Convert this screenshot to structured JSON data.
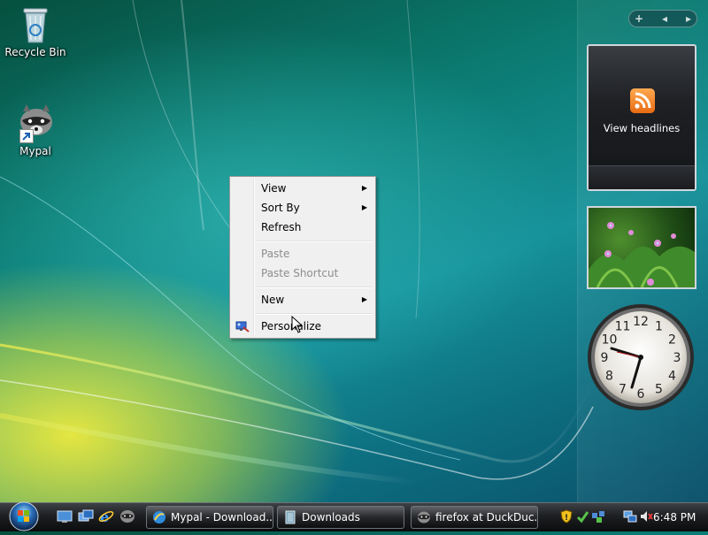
{
  "desktop": {
    "icons": [
      {
        "label": "Recycle Bin",
        "icon": "recycle-bin-icon"
      },
      {
        "label": "Mypal",
        "icon": "mypal-raccoon-icon"
      }
    ]
  },
  "sidebar": {
    "toolbar": {
      "add": "+",
      "prev": "◂",
      "next": "▸"
    },
    "feed_gadget": {
      "text": "View headlines",
      "icon": "rss-icon"
    },
    "slideshow_gadget": {
      "subject": "pink flowers and green plants"
    },
    "clock_gadget": {
      "numerals": [
        "12",
        "1",
        "2",
        "3",
        "4",
        "5",
        "6",
        "7",
        "8",
        "9",
        "10",
        "11"
      ],
      "time_shown": "6:48"
    }
  },
  "context_menu": {
    "items": [
      {
        "label": "View",
        "submenu": true,
        "enabled": true
      },
      {
        "label": "Sort By",
        "submenu": true,
        "enabled": true
      },
      {
        "label": "Refresh",
        "submenu": false,
        "enabled": true
      },
      {
        "label": "Paste",
        "submenu": false,
        "enabled": false
      },
      {
        "label": "Paste Shortcut",
        "submenu": false,
        "enabled": false
      },
      {
        "label": "New",
        "submenu": true,
        "enabled": true
      },
      {
        "label": "Personalize",
        "submenu": false,
        "enabled": true,
        "icon": "personalize-display-icon"
      }
    ],
    "submenu_arrow": "▶"
  },
  "taskbar": {
    "quick_launch": [
      "show-desktop-icon",
      "switch-windows-icon",
      "internet-explorer-icon",
      "mypal-icon"
    ],
    "tasks": [
      {
        "label": "Mypal - Download...",
        "icon": "mypal-browser-icon"
      },
      {
        "label": "Downloads",
        "icon": "folder-icon"
      },
      {
        "label": "firefox at DuckDuc...",
        "icon": "mypal-raccoon-icon"
      }
    ],
    "tray": {
      "icons": [
        "security-alert-shield-icon",
        "defender-icon",
        "network-share-icon",
        "network-icon",
        "volume-muted-icon"
      ],
      "time": "6:48 PM"
    }
  },
  "colors": {
    "menu_bg": "#f0f0f0",
    "taskbar_top": "#3e4145",
    "taskbar_bottom": "#0b0c0d"
  }
}
